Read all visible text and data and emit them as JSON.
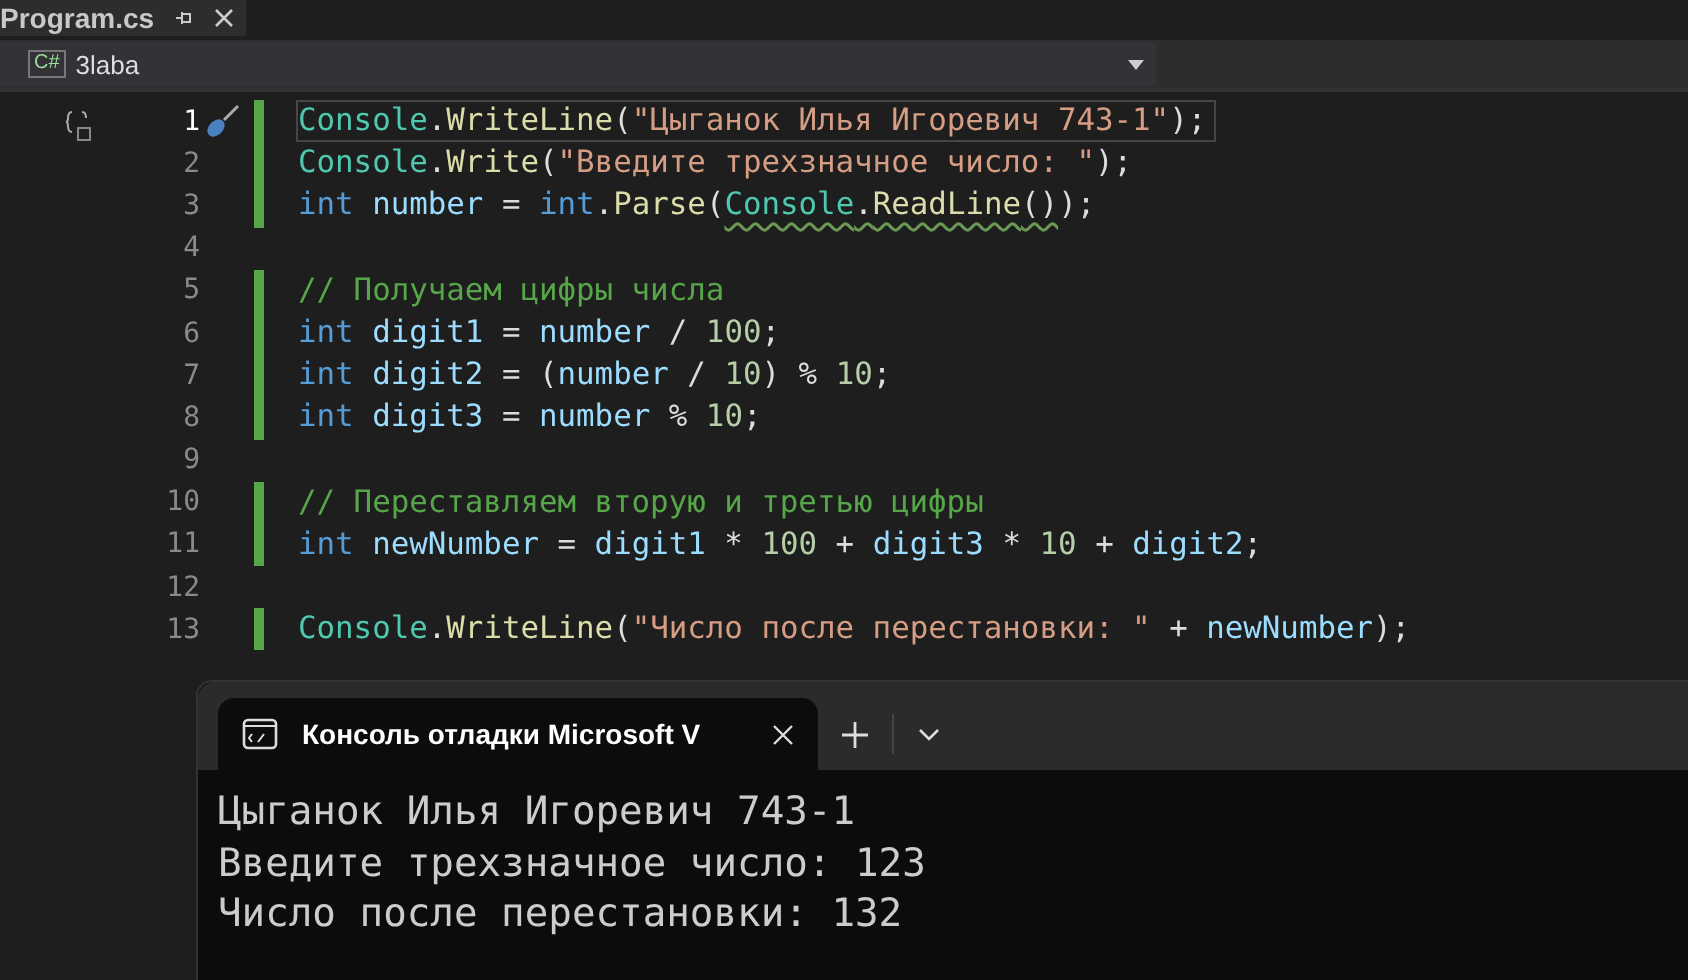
{
  "file_tab": {
    "title": "Program.cs",
    "selected": true
  },
  "nav_bar": {
    "project": "3laba",
    "language_badge": "C#"
  },
  "editor": {
    "lines": [
      {
        "number": "1",
        "changed": true,
        "current": true,
        "tokens": [
          {
            "t": "Console",
            "kind": "class"
          },
          {
            "t": ".",
            "kind": "punct"
          },
          {
            "t": "WriteLine",
            "kind": "method"
          },
          {
            "t": "(",
            "kind": "punct"
          },
          {
            "t": "\"Цыганок Илья Игоревич 743-1\"",
            "kind": "string"
          },
          {
            "t": ");",
            "kind": "punct"
          }
        ]
      },
      {
        "number": "2",
        "changed": true,
        "current": false,
        "tokens": [
          {
            "t": "Console",
            "kind": "class"
          },
          {
            "t": ".",
            "kind": "punct"
          },
          {
            "t": "Write",
            "kind": "method"
          },
          {
            "t": "(",
            "kind": "punct"
          },
          {
            "t": "\"Введите трехзначное число: \"",
            "kind": "string"
          },
          {
            "t": ");",
            "kind": "punct"
          }
        ]
      },
      {
        "number": "3",
        "changed": true,
        "current": false,
        "tokens": [
          {
            "t": "int ",
            "kind": "keyword"
          },
          {
            "t": "number",
            "kind": "ident"
          },
          {
            "t": " = ",
            "kind": "punct"
          },
          {
            "t": "int",
            "kind": "keyword"
          },
          {
            "t": ".",
            "kind": "punct"
          },
          {
            "t": "Parse",
            "kind": "method"
          },
          {
            "t": "(",
            "kind": "punct"
          },
          {
            "t": "Console",
            "kind": "class",
            "squiggle": true
          },
          {
            "t": ".",
            "kind": "punct",
            "squiggle": true
          },
          {
            "t": "ReadLine",
            "kind": "method",
            "squiggle": true
          },
          {
            "t": "()",
            "kind": "punct",
            "squiggle": true
          },
          {
            "t": ");",
            "kind": "punct",
            "squiggle": false
          }
        ]
      },
      {
        "number": "4",
        "changed": false,
        "current": false
      },
      {
        "number": "5",
        "changed": true,
        "current": false,
        "tokens": [
          {
            "t": "// Получаем цифры числа",
            "kind": "comment"
          }
        ]
      },
      {
        "number": "6",
        "changed": true,
        "current": false,
        "tokens": [
          {
            "t": "int ",
            "kind": "keyword"
          },
          {
            "t": "digit1",
            "kind": "ident"
          },
          {
            "t": " = ",
            "kind": "punct"
          },
          {
            "t": "number",
            "kind": "ident"
          },
          {
            "t": " / ",
            "kind": "punct"
          },
          {
            "t": "100",
            "kind": "number"
          },
          {
            "t": ";",
            "kind": "punct"
          }
        ]
      },
      {
        "number": "7",
        "changed": true,
        "current": false,
        "tokens": [
          {
            "t": "int ",
            "kind": "keyword"
          },
          {
            "t": "digit2",
            "kind": "ident"
          },
          {
            "t": " = (",
            "kind": "punct"
          },
          {
            "t": "number",
            "kind": "ident"
          },
          {
            "t": " / ",
            "kind": "punct"
          },
          {
            "t": "10",
            "kind": "number"
          },
          {
            "t": ") % ",
            "kind": "punct"
          },
          {
            "t": "10",
            "kind": "number"
          },
          {
            "t": ";",
            "kind": "punct"
          }
        ]
      },
      {
        "number": "8",
        "changed": true,
        "current": false,
        "tokens": [
          {
            "t": "int ",
            "kind": "keyword"
          },
          {
            "t": "digit3",
            "kind": "ident"
          },
          {
            "t": " = ",
            "kind": "punct"
          },
          {
            "t": "number",
            "kind": "ident"
          },
          {
            "t": " % ",
            "kind": "punct"
          },
          {
            "t": "10",
            "kind": "number"
          },
          {
            "t": ";",
            "kind": "punct"
          }
        ]
      },
      {
        "number": "9",
        "changed": false,
        "current": false
      },
      {
        "number": "10",
        "changed": true,
        "current": false,
        "tokens": [
          {
            "t": "// Переставляем вторую и третью цифры",
            "kind": "comment"
          }
        ]
      },
      {
        "number": "11",
        "changed": true,
        "current": false,
        "tokens": [
          {
            "t": "int ",
            "kind": "keyword"
          },
          {
            "t": "newNumber",
            "kind": "ident"
          },
          {
            "t": " = ",
            "kind": "punct"
          },
          {
            "t": "digit1",
            "kind": "ident"
          },
          {
            "t": " * ",
            "kind": "punct"
          },
          {
            "t": "100",
            "kind": "number"
          },
          {
            "t": " + ",
            "kind": "punct"
          },
          {
            "t": "digit3",
            "kind": "ident"
          },
          {
            "t": " * ",
            "kind": "punct"
          },
          {
            "t": "10",
            "kind": "number"
          },
          {
            "t": " + ",
            "kind": "punct"
          },
          {
            "t": "digit2",
            "kind": "ident"
          },
          {
            "t": ";",
            "kind": "punct"
          }
        ]
      },
      {
        "number": "12",
        "changed": false,
        "current": false
      },
      {
        "number": "13",
        "changed": true,
        "current": false,
        "tokens": [
          {
            "t": "Console",
            "kind": "class"
          },
          {
            "t": ".",
            "kind": "punct"
          },
          {
            "t": "WriteLine",
            "kind": "method"
          },
          {
            "t": "(",
            "kind": "punct"
          },
          {
            "t": "\"Число после перестановки: \"",
            "kind": "string"
          },
          {
            "t": " + ",
            "kind": "punct"
          },
          {
            "t": "newNumber",
            "kind": "ident"
          },
          {
            "t": ");",
            "kind": "punct"
          }
        ]
      }
    ]
  },
  "console": {
    "tab_title": "Консоль отладки Microsoft V",
    "output": [
      "Цыганок Илья Игоревич 743-1",
      "Введите трехзначное число: 123",
      "Число после перестановки: 132"
    ]
  }
}
